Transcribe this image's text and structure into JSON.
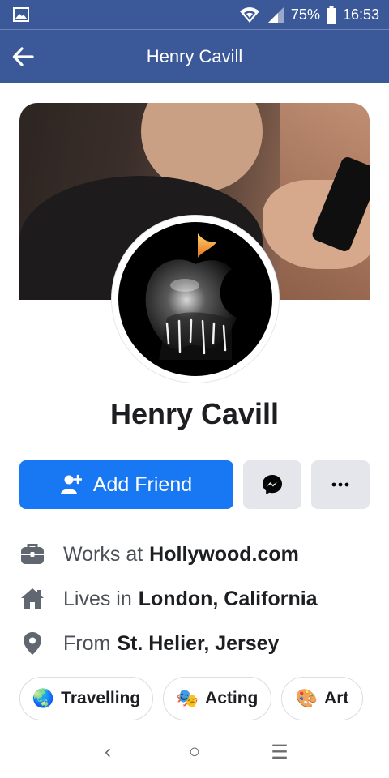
{
  "status_bar": {
    "battery_percent": "75%",
    "time": "16:53",
    "icons": [
      "gallery-icon",
      "wifi-icon",
      "signal-icon",
      "battery-icon"
    ]
  },
  "app_bar": {
    "title": "Henry Cavill",
    "back_icon": "back-arrow-icon"
  },
  "profile": {
    "name": "Henry Cavill"
  },
  "actions": {
    "add_friend_label": "Add Friend",
    "add_friend_icon": "add-friend-icon",
    "messenger_icon": "messenger-icon",
    "more_icon": "more-icon",
    "more_label": "···"
  },
  "details": [
    {
      "icon": "briefcase-icon",
      "prefix": "Works at",
      "value": "Hollywood.com"
    },
    {
      "icon": "home-icon",
      "prefix": "Lives in",
      "value": "London, California"
    },
    {
      "icon": "location-pin-icon",
      "prefix": "From",
      "value": "St. Helier, Jersey"
    }
  ],
  "interests": [
    {
      "emoji": "🌏",
      "label": "Travelling"
    },
    {
      "emoji": "🎭",
      "label": "Acting"
    },
    {
      "emoji": "🎨",
      "label": "Art"
    }
  ],
  "nav_bar": {
    "back": "‹",
    "home": "○",
    "recents": "☰"
  },
  "colors": {
    "brand_blue": "#3b5998",
    "button_blue": "#1877f2",
    "button_grey": "#e4e6eb"
  }
}
